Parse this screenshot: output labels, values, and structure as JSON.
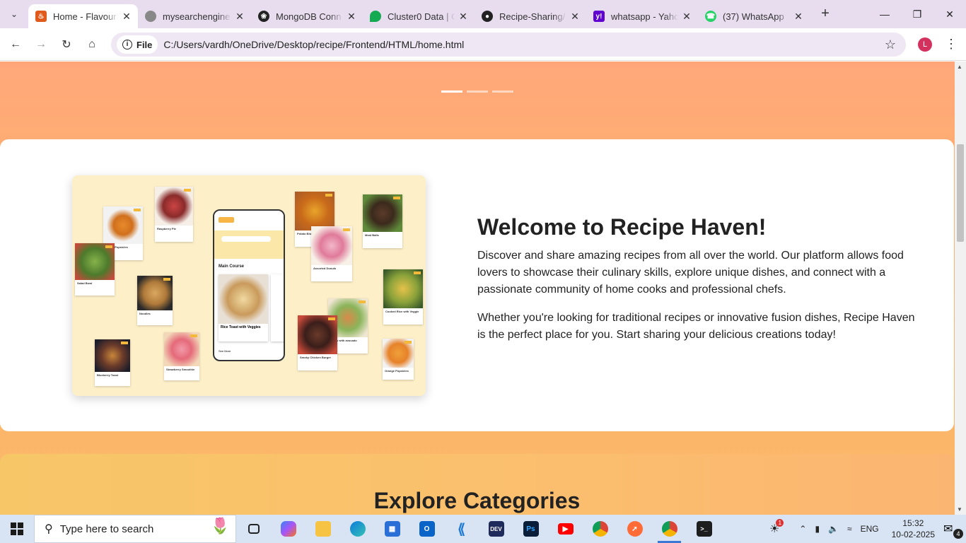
{
  "browser": {
    "tabs": [
      {
        "title": "Home - FlavourS",
        "favicon": "recipe-logo-icon",
        "color": "#e05a1b",
        "active": true
      },
      {
        "title": "mysearchengine",
        "favicon": "globe-icon",
        "color": "#777777",
        "active": false
      },
      {
        "title": "MongoDB Conn",
        "favicon": "openai-icon",
        "color": "#222222",
        "active": false
      },
      {
        "title": "Cluster0 Data | C",
        "favicon": "mongodb-leaf-icon",
        "color": "#13aa52",
        "active": false
      },
      {
        "title": "Recipe-Sharing/",
        "favicon": "github-icon",
        "color": "#222222",
        "active": false
      },
      {
        "title": "whatsapp - Yaho",
        "favicon": "yahoo-icon",
        "color": "#6001d2",
        "active": false
      },
      {
        "title": "(37) WhatsApp",
        "favicon": "whatsapp-icon",
        "color": "#25d366",
        "active": false
      }
    ],
    "address": {
      "chip_label": "File",
      "url": "C:/Users/vardh/OneDrive/Desktop/recipe/Frontend/HTML/home.html"
    },
    "profile_initial": "L"
  },
  "page": {
    "welcome": {
      "title": "Welcome to Recipe Haven!",
      "paragraph1": "Discover and share amazing recipes from all over the world. Our platform allows food lovers to showcase their culinary skills, explore unique dishes, and connect with a passionate community of home cooks and professional chefs.",
      "paragraph2": "Whether you're looking for traditional recipes or innovative fusion dishes, Recipe Haven is the perfect place for you. Start sharing your delicious creations today!"
    },
    "collage": {
      "section_label": "Main Course",
      "featured_recipe": "Rice Toast with Veggies",
      "see_more": "See More",
      "cards": [
        "Raspberry Pie",
        "Carrot Popsicles",
        "Potato Bhaji",
        "Meat Balls",
        "Salad Bowl",
        "Noodles",
        "Assorted Donuts",
        "Cooked Rice with Veggie",
        "Blueberry Toast",
        "Strawberry Smoothie",
        "Tacos with avocado",
        "Smoky Chicken Burger",
        "Orange Popsicles"
      ]
    },
    "categories_title": "Explore Categories"
  },
  "taskbar": {
    "search_placeholder": "Type here to search",
    "language": "ENG",
    "time": "15:32",
    "date": "10-02-2025",
    "notification_count": "4",
    "weather_badge": "1"
  }
}
